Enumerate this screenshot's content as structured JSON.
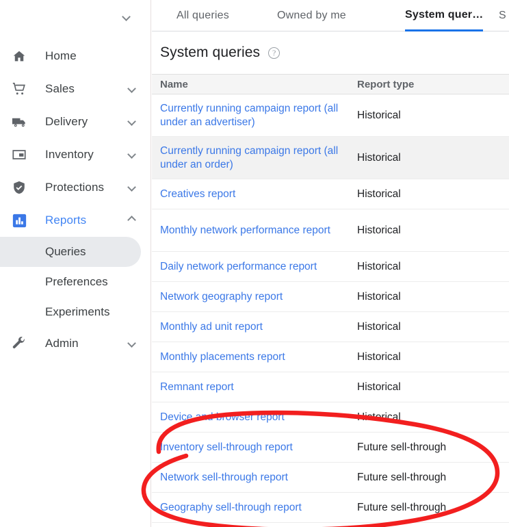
{
  "sidebar": {
    "collapse_icon": "chevron-down-icon",
    "items": [
      {
        "label": "Home",
        "icon": "home-icon",
        "expandable": false,
        "active": false
      },
      {
        "label": "Sales",
        "icon": "cart-icon",
        "expandable": true,
        "chevron": "chevron-down-icon",
        "active": false
      },
      {
        "label": "Delivery",
        "icon": "truck-icon",
        "expandable": true,
        "chevron": "chevron-down-icon",
        "active": false
      },
      {
        "label": "Inventory",
        "icon": "inventory-icon",
        "expandable": true,
        "chevron": "chevron-down-icon",
        "active": false
      },
      {
        "label": "Protections",
        "icon": "shield-check-icon",
        "expandable": true,
        "chevron": "chevron-down-icon",
        "active": false
      },
      {
        "label": "Reports",
        "icon": "bar-chart-icon",
        "expandable": true,
        "chevron": "chevron-up-icon",
        "active": true
      }
    ],
    "sub_items": [
      {
        "label": "Queries",
        "selected": true
      },
      {
        "label": "Preferences",
        "selected": false
      },
      {
        "label": "Experiments",
        "selected": false
      }
    ],
    "footer_items": [
      {
        "label": "Admin",
        "icon": "wrench-icon",
        "expandable": true,
        "chevron": "chevron-down-icon"
      }
    ],
    "accent_color": "#4285f4",
    "selected_pill_color": "#e8eaed"
  },
  "main": {
    "tabs": [
      {
        "label": "All queries",
        "active": false
      },
      {
        "label": "Owned by me",
        "active": false
      },
      {
        "label": "System quer…",
        "active": true
      },
      {
        "label": "S",
        "active": false
      }
    ],
    "active_tab_underline_color": "#1a73e8",
    "title": "System queries",
    "help_icon": "help-circle-icon",
    "table": {
      "columns": [
        "Name",
        "Report type"
      ],
      "rows": [
        {
          "name": "Currently running campaign report (all under an advertiser)",
          "type": "Historical",
          "two_line": true,
          "hover": false
        },
        {
          "name": "Currently running campaign report (all under an order)",
          "type": "Historical",
          "two_line": true,
          "hover": true
        },
        {
          "name": "Creatives report",
          "type": "Historical",
          "two_line": false,
          "hover": false
        },
        {
          "name": "Monthly network performance report",
          "type": "Historical",
          "two_line": true,
          "hover": false
        },
        {
          "name": "Daily network performance report",
          "type": "Historical",
          "two_line": false,
          "hover": false
        },
        {
          "name": "Network geography report",
          "type": "Historical",
          "two_line": false,
          "hover": false
        },
        {
          "name": "Monthly ad unit report",
          "type": "Historical",
          "two_line": false,
          "hover": false
        },
        {
          "name": "Monthly placements report",
          "type": "Historical",
          "two_line": false,
          "hover": false
        },
        {
          "name": "Remnant report",
          "type": "Historical",
          "two_line": false,
          "hover": false
        },
        {
          "name": "Device and browser report",
          "type": "Historical",
          "two_line": false,
          "hover": false
        },
        {
          "name": "Inventory sell-through report",
          "type": "Future sell-through",
          "two_line": false,
          "hover": false
        },
        {
          "name": "Network sell-through report",
          "type": "Future sell-through",
          "two_line": false,
          "hover": false
        },
        {
          "name": "Geography sell-through report",
          "type": "Future sell-through",
          "two_line": false,
          "hover": false
        }
      ]
    },
    "link_color": "#3b78e7"
  },
  "annotation": {
    "type": "hand-drawn-ellipse",
    "color": "#f21f1f",
    "encircles": [
      "Inventory sell-through report",
      "Network sell-through report",
      "Geography sell-through report"
    ]
  }
}
